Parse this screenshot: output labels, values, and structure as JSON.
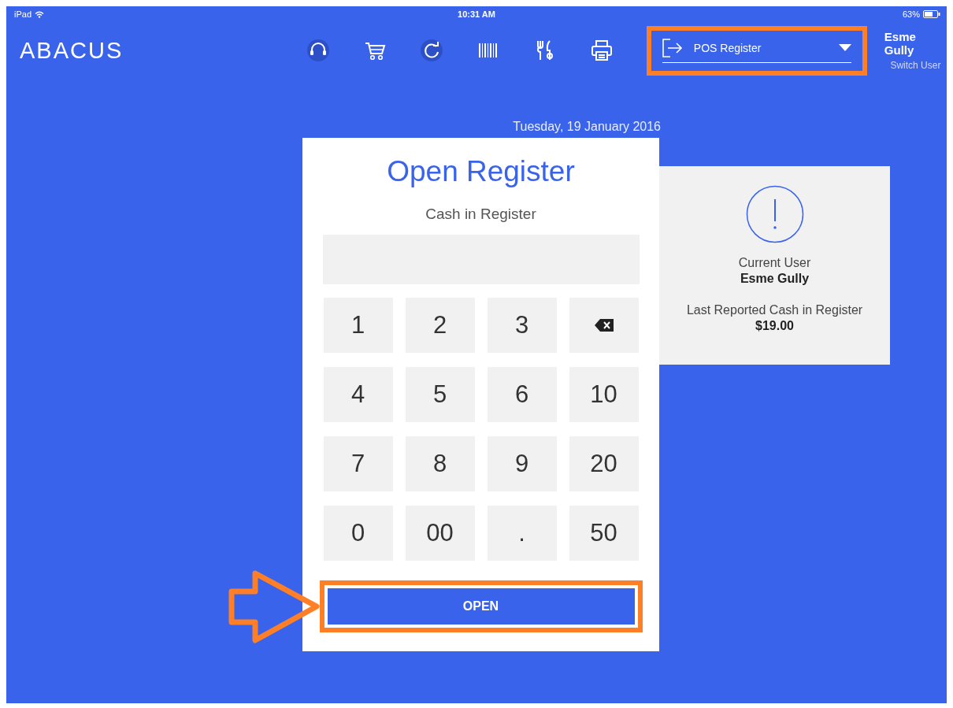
{
  "status_bar": {
    "device": "iPad",
    "time": "10:31 AM",
    "battery": "63%"
  },
  "top_bar": {
    "logo": "ABACUS",
    "toolbar_icons": [
      {
        "kind": "headset"
      },
      {
        "kind": "cart"
      },
      {
        "kind": "refresh"
      },
      {
        "kind": "barcode"
      },
      {
        "kind": "utensils"
      },
      {
        "kind": "printer"
      }
    ],
    "register_dropdown": {
      "value": "POS Register",
      "highlighted": true
    },
    "user": {
      "name": "Esme Gully",
      "action": "Switch User"
    }
  },
  "date": "Tuesday, 19 January 2016",
  "register_card": {
    "title": "Open Register",
    "field_label": "Cash in Register",
    "keys": [
      {
        "kind": "digit",
        "label": "1"
      },
      {
        "kind": "digit",
        "label": "2"
      },
      {
        "kind": "digit",
        "label": "3"
      },
      {
        "kind": "backspace"
      },
      {
        "kind": "digit",
        "label": "4"
      },
      {
        "kind": "digit",
        "label": "5"
      },
      {
        "kind": "digit",
        "label": "6"
      },
      {
        "kind": "digit",
        "label": "10"
      },
      {
        "kind": "digit",
        "label": "7"
      },
      {
        "kind": "digit",
        "label": "8"
      },
      {
        "kind": "digit",
        "label": "9"
      },
      {
        "kind": "digit",
        "label": "20"
      },
      {
        "kind": "digit",
        "label": "0"
      },
      {
        "kind": "digit",
        "label": "00"
      },
      {
        "kind": "digit",
        "label": "."
      },
      {
        "kind": "digit",
        "label": "50"
      }
    ],
    "open_button": {
      "label": "OPEN",
      "highlighted": true,
      "pointer_arrow": true
    }
  },
  "info_panel": {
    "user_label": "Current User",
    "user_name": "Esme Gully",
    "cash_label": "Last Reported Cash in Register",
    "cash_value": "$19.00"
  }
}
